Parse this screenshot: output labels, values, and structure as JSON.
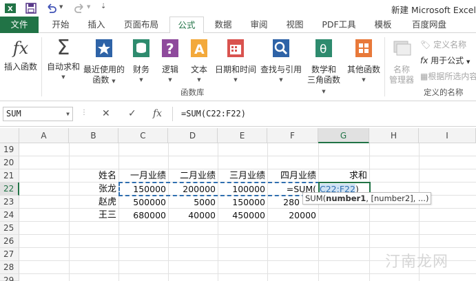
{
  "window": {
    "title": "新建 Microsoft Excel"
  },
  "tabs": {
    "file": "文件",
    "items": [
      "开始",
      "插入",
      "页面布局",
      "公式",
      "数据",
      "审阅",
      "视图",
      "PDF工具",
      "模板",
      "百度网盘"
    ],
    "active": "公式"
  },
  "ribbon": {
    "insert_function": "插入函数",
    "autosum": "自动求和",
    "recently_used_1": "最近使用的",
    "recently_used_2": "函数",
    "financial": "财务",
    "logical": "逻辑",
    "text": "文本",
    "datetime": "日期和时间",
    "lookup": "查找与引用",
    "math_1": "数学和",
    "math_2": "三角函数",
    "more": "其他函数",
    "group_library": "函数库",
    "name_manager_1": "名称",
    "name_manager_2": "管理器",
    "define_name": "定义名称",
    "use_in_formula": "用于公式",
    "create_from_selection": "根据所选内容",
    "group_names": "定义的名称"
  },
  "formula_bar": {
    "name_box": "SUM",
    "cancel": "✕",
    "enter": "✓",
    "fx": "fx",
    "formula": "=SUM(C22:F22)"
  },
  "grid": {
    "columns": [
      "A",
      "B",
      "C",
      "D",
      "E",
      "F",
      "G",
      "H",
      "I"
    ],
    "selected_column": "G",
    "rows": [
      "19",
      "20",
      "21",
      "22",
      "23",
      "24",
      "25",
      "26",
      "27",
      "28",
      "29"
    ],
    "selected_row": "22",
    "headers": {
      "name": "姓名",
      "jan": "一月业绩",
      "feb": "二月业绩",
      "mar": "三月业绩",
      "apr": "四月业绩",
      "sum": "求和"
    },
    "data_rows": [
      {
        "name": "张龙",
        "c": "150000",
        "d": "200000",
        "e": "100000",
        "f": "=SUM("
      },
      {
        "name": "赵虎",
        "c": "500000",
        "d": "5000",
        "e": "150000",
        "f": "280"
      },
      {
        "name": "王三",
        "c": "680000",
        "d": "40000",
        "e": "450000",
        "f": "20000"
      }
    ],
    "editing": {
      "prefix": "=SUM(",
      "ref": "C22:F22",
      "suffix": ")"
    }
  },
  "tooltip": {
    "fn": "SUM(",
    "arg1": "number1",
    "rest": ", [number2], ...)"
  },
  "watermark": "汀南龙网",
  "colors": {
    "excel_green": "#217346",
    "ref_blue": "#2f6fb0"
  }
}
